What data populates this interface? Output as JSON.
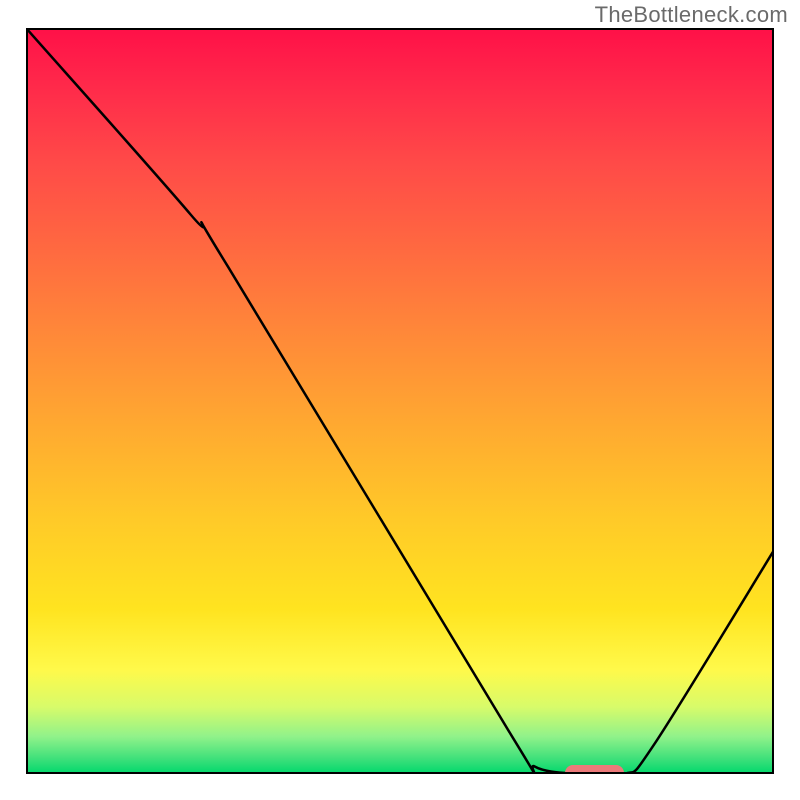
{
  "watermark": "TheBottleneck.com",
  "chart_data": {
    "type": "line",
    "title": "",
    "xlabel": "",
    "ylabel": "",
    "xlim": [
      0,
      100
    ],
    "ylim": [
      0,
      100
    ],
    "grid": false,
    "single_series": true,
    "curve_points": [
      {
        "x": 0,
        "y": 100
      },
      {
        "x": 22,
        "y": 75
      },
      {
        "x": 27,
        "y": 68
      },
      {
        "x": 65,
        "y": 5
      },
      {
        "x": 68,
        "y": 1
      },
      {
        "x": 74,
        "y": 0
      },
      {
        "x": 80,
        "y": 0
      },
      {
        "x": 84,
        "y": 4
      },
      {
        "x": 100,
        "y": 30
      }
    ],
    "optimal_range": {
      "x_start": 72,
      "x_end": 80,
      "y": 0
    },
    "background_gradient": [
      {
        "pos": 0,
        "color": "#ff1048"
      },
      {
        "pos": 50,
        "color": "#ff9a34"
      },
      {
        "pos": 80,
        "color": "#ffe720"
      },
      {
        "pos": 100,
        "color": "#00d86c"
      }
    ],
    "curve_color": "#000000",
    "marker_color": "#ec7a7a"
  }
}
